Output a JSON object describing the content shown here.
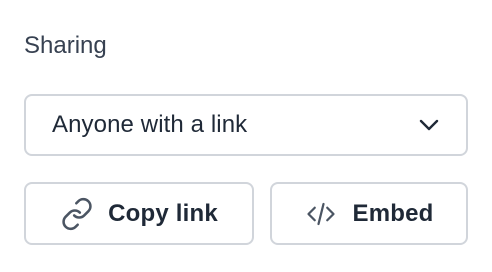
{
  "sharing": {
    "label": "Sharing",
    "select": {
      "value": "Anyone with a link",
      "icon": "chevron-down-icon"
    },
    "copy_button": {
      "label": "Copy link",
      "icon": "link-icon"
    },
    "embed_button": {
      "label": "Embed",
      "icon": "code-icon"
    }
  },
  "colors": {
    "text": "#1f2937",
    "border": "#d1d5db",
    "icon": "#4b5563"
  }
}
